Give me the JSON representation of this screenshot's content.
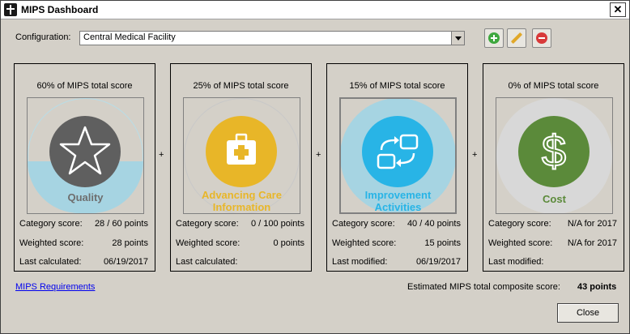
{
  "window": {
    "title": "MIPS Dashboard",
    "close_glyph": "✕"
  },
  "config": {
    "label": "Configuration:",
    "value": "Central Medical Facility"
  },
  "toolbar": {
    "add_icon": "add-icon",
    "edit_icon": "pencil-icon",
    "remove_icon": "remove-icon"
  },
  "cards": [
    {
      "pct": "60% of MIPS total score",
      "name": "Quality",
      "icon": "star-icon",
      "color": "#5f5f5f",
      "name_color": "#6e6e6e",
      "row1_label": "Category score:",
      "row1_value": "28 / 60 points",
      "row2_label": "Weighted score:",
      "row2_value": "28 points",
      "row3_label": "Last calculated:",
      "row3_value": "06/19/2017",
      "fill_fraction": 0.47
    },
    {
      "pct": "25% of MIPS total score",
      "name_line1": "Advancing Care",
      "name_line2": "Information",
      "icon": "medical-cross-icon",
      "color": "#e8b628",
      "name_color": "#e8b628",
      "row1_label": "Category score:",
      "row1_value": "0 / 100 points",
      "row2_label": "Weighted score:",
      "row2_value": "0 points",
      "row3_label": "Last calculated:",
      "row3_value": "",
      "fill_fraction": 0
    },
    {
      "pct": "15% of MIPS total score",
      "name_line1": "Improvement",
      "name_line2": "Activities",
      "icon": "cycle-arrows-icon",
      "color": "#28b4e6",
      "name_color": "#28b4e6",
      "row1_label": "Category score:",
      "row1_value": "40 / 40 points",
      "row2_label": "Weighted score:",
      "row2_value": "15 points",
      "row3_label": "Last modified:",
      "row3_value": "06/19/2017",
      "fill_fraction": 1
    },
    {
      "pct": "0% of MIPS total score",
      "name": "Cost",
      "icon": "dollar-icon",
      "color": "#5b8a3a",
      "name_color": "#5b8a3a",
      "row1_label": "Category score:",
      "row1_value": "N/A for 2017",
      "row2_label": "Weighted score:",
      "row2_value": "N/A for 2017",
      "row3_label": "Last modified:",
      "row3_value": "",
      "fill_fraction": 0
    }
  ],
  "plus_sign": "+",
  "footer": {
    "link": "MIPS Requirements",
    "composite_label": "Estimated MIPS total composite score:",
    "composite_value": "43 points",
    "close_label": "Close"
  }
}
